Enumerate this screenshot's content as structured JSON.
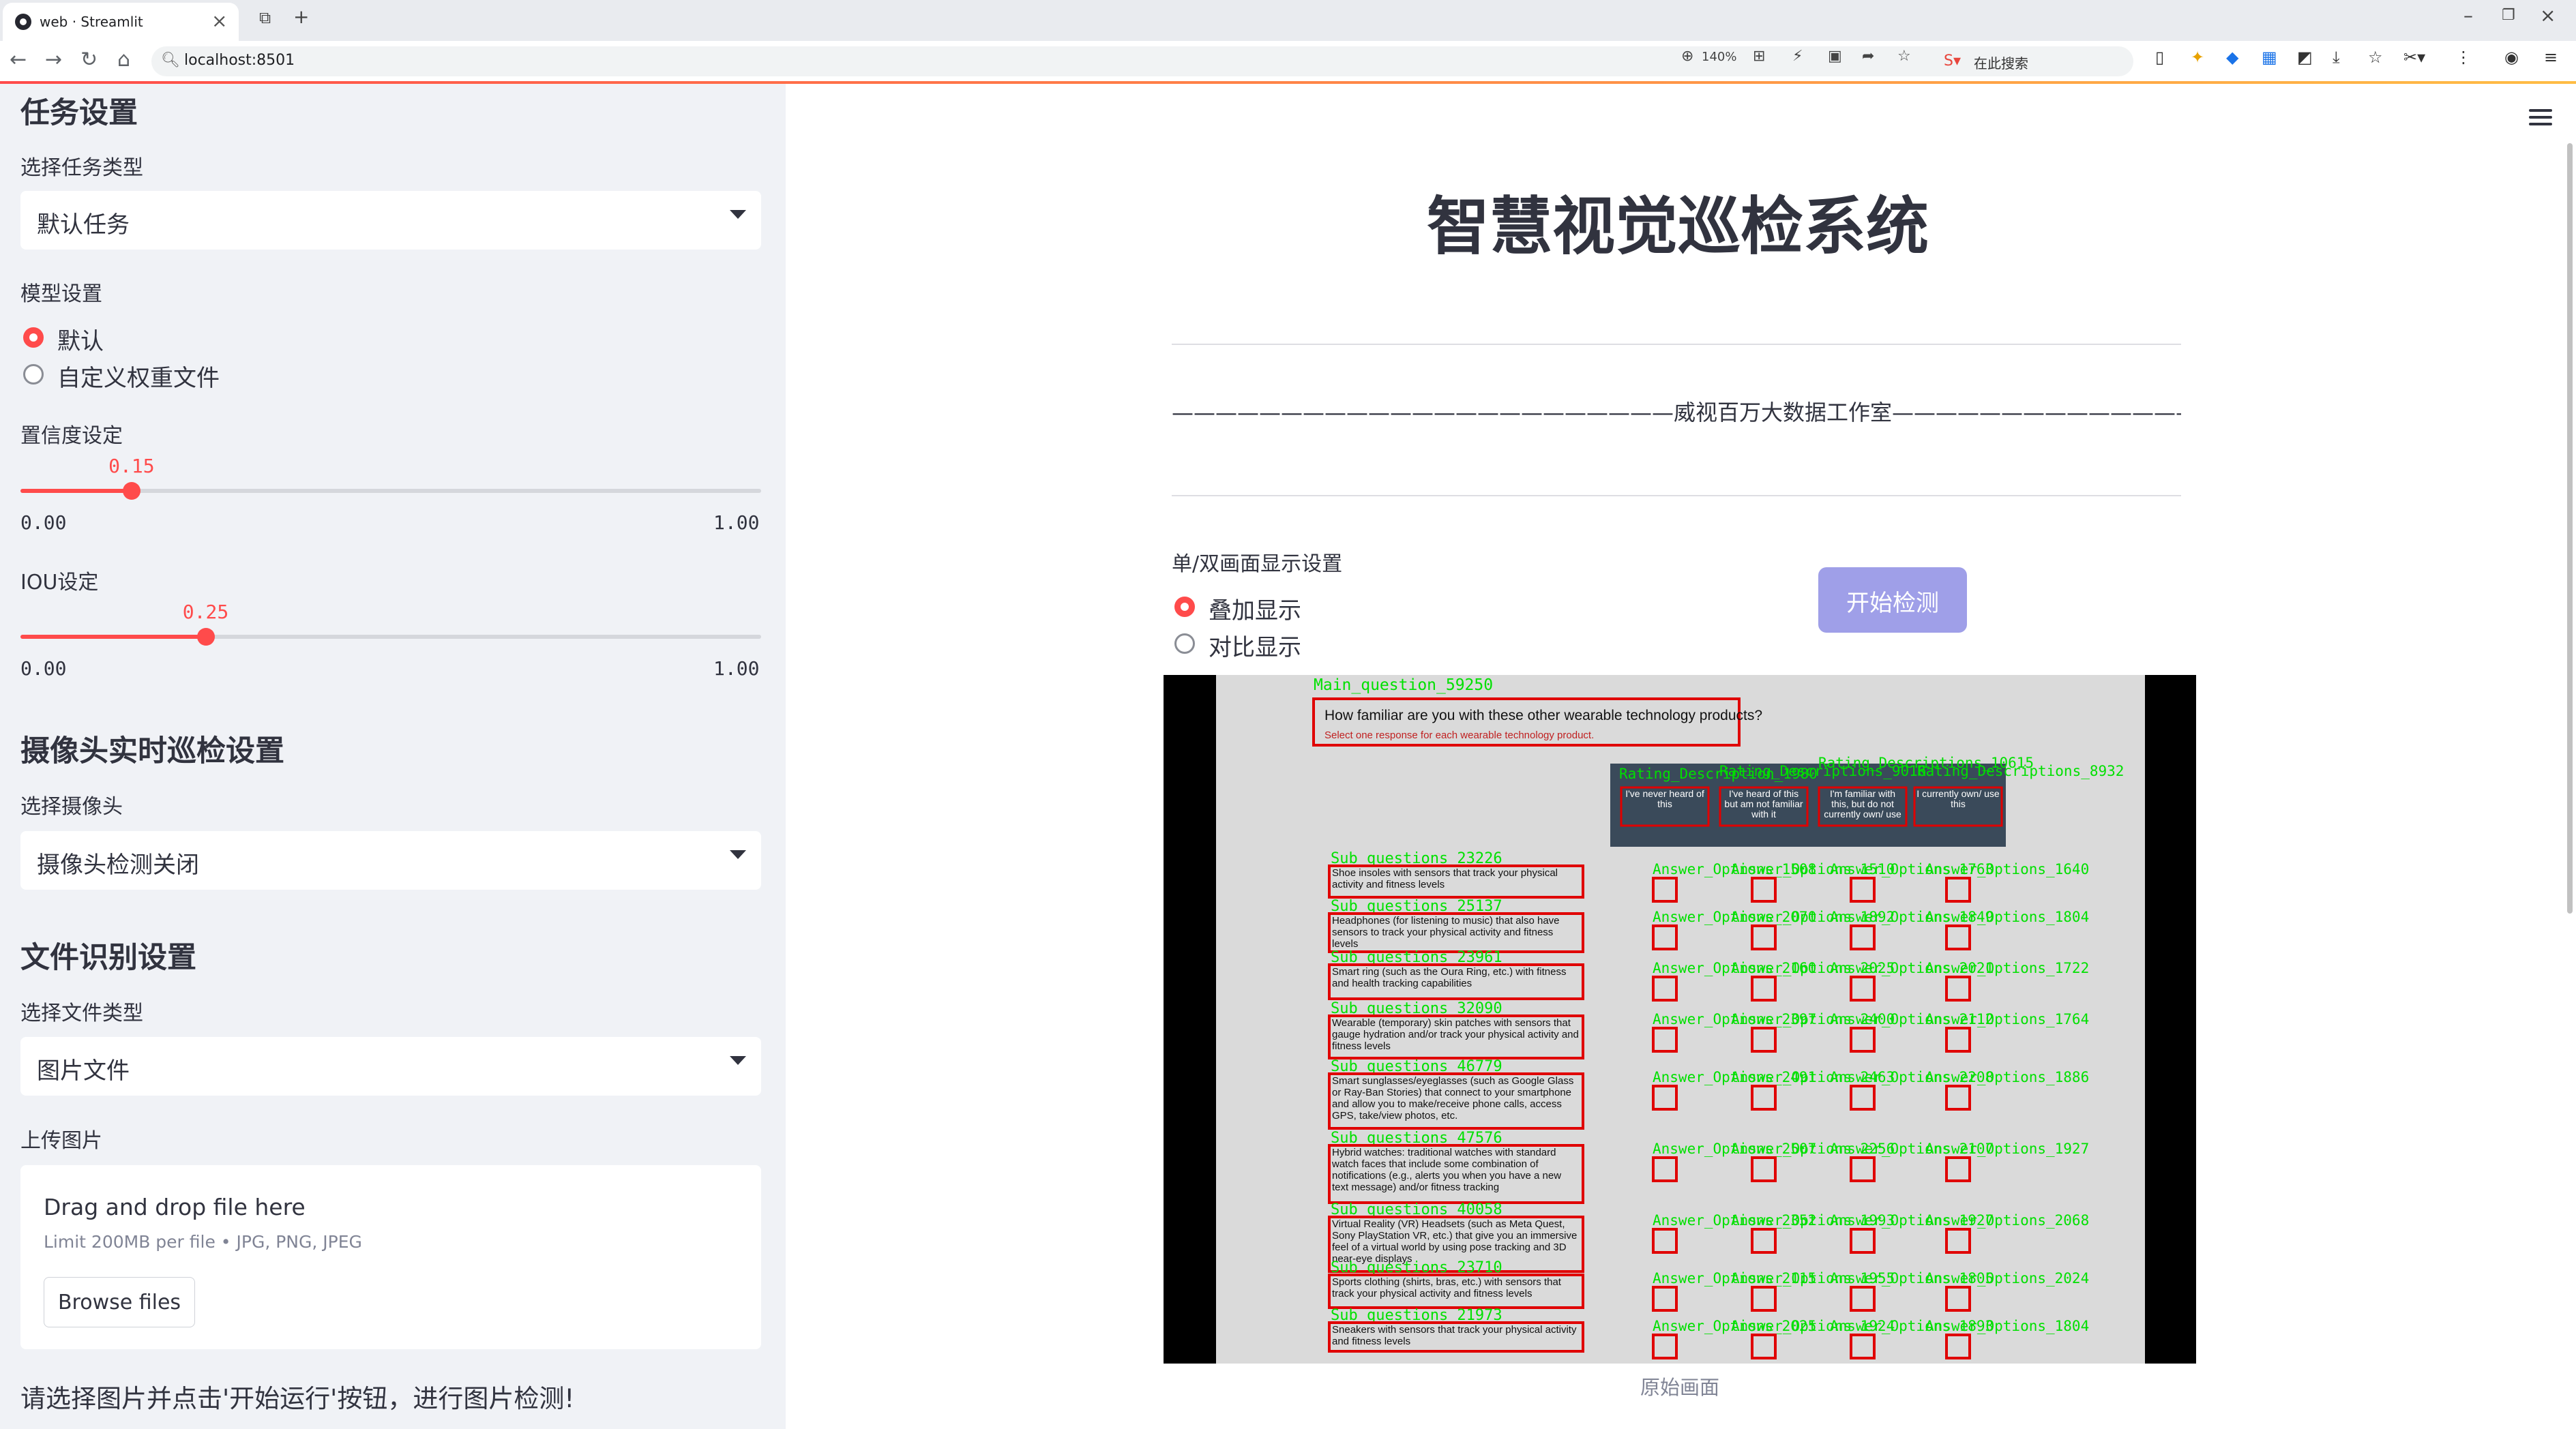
{
  "browser": {
    "tab_title": "web · Streamlit",
    "url": "localhost:8501",
    "zoom": "140%",
    "search_placeholder": "在此搜索"
  },
  "sidebar": {
    "task_heading": "任务设置",
    "task_type_label": "选择任务类型",
    "task_type_value": "默认任务",
    "model_label": "模型设置",
    "model_options": [
      "默认",
      "自定义权重文件"
    ],
    "model_selected": 0,
    "confidence": {
      "label": "置信度设定",
      "value": 0.15,
      "value_text": "0.15",
      "min": "0.00",
      "max": "1.00"
    },
    "iou": {
      "label": "IOU设定",
      "value": 0.25,
      "value_text": "0.25",
      "min": "0.00",
      "max": "1.00"
    },
    "camera_heading": "摄像头实时巡检设置",
    "camera_label": "选择摄像头",
    "camera_value": "摄像头检测关闭",
    "file_heading": "文件识别设置",
    "file_type_label": "选择文件类型",
    "file_type_value": "图片文件",
    "upload_label": "上传图片",
    "upload": {
      "drag_text": "Drag and drop file here",
      "limit_text": "Limit 200MB per file • JPG, PNG, JPEG",
      "browse_label": "Browse files"
    },
    "hint": "请选择图片并点击'开始运行'按钮，进行图片检测!"
  },
  "main": {
    "title": "智慧视觉巡检系统",
    "studio_line": "———————————————————————威视百万大数据工作室————————————————————————",
    "display_label": "单/双画面显示设置",
    "display_options": [
      "叠加显示",
      "对比显示"
    ],
    "display_selected": 0,
    "start_button": "开始检测",
    "image_caption": "原始画面"
  },
  "survey_image": {
    "main_question_tag": "Main_question_59250",
    "question": "How familiar are you with these other wearable technology products?",
    "question_note": "Select one response for each wearable technology product.",
    "rating_tags": [
      "Rating_Description_1980",
      "Rating_Descriptions_9016",
      "Rating_Descriptions_10615",
      "Rating_Descriptions_8932"
    ],
    "rating_headers": [
      "I've never heard of this",
      "I've heard of this but am not familiar with it",
      "I'm familiar with this, but do not currently own/ use",
      "I currently own/ use this"
    ],
    "rows": [
      {
        "tag": "Sub_questions_23226",
        "text": "Shoe insoles with sensors that track your physical activity and fitness levels",
        "answers": [
          "Answer_Options_1508",
          "Answer_Options_1510",
          "Answer_Options_1763",
          "Answer_Options_1640"
        ]
      },
      {
        "tag": "Sub_questions_25137",
        "text": "Headphones (for listening to music) that also have sensors to track your physical activity and fitness levels",
        "answers": [
          "Answer_Options_2070",
          "Answer_Options_1892",
          "Answer_Options_1849",
          "Answer_Options_1804"
        ]
      },
      {
        "tag": "Sub_questions_23961",
        "text": "Smart ring (such as the Oura Ring, etc.) with fitness and health tracking capabilities",
        "answers": [
          "Answer_Options_2160",
          "Answer_Options_2025",
          "Answer_Options_2021",
          "Answer_Options_1722"
        ]
      },
      {
        "tag": "Sub_questions_32090",
        "text": "Wearable (temporary) skin patches with sensors that gauge hydration and/or track your physical activity and fitness levels",
        "answers": [
          "Answer_Options_2397",
          "Answer_Options_2400",
          "Answer_Options_2112",
          "Answer_Options_1764"
        ]
      },
      {
        "tag": "Sub_questions_46779",
        "text": "Smart sunglasses/eyeglasses (such as Google Glass or Ray-Ban Stories) that connect to your smartphone and allow you to make/receive phone calls, access GPS, take/view photos, etc.",
        "answers": [
          "Answer_Options_2491",
          "Answer_Options_2463",
          "Answer_Options_2208",
          "Answer_Options_1886"
        ]
      },
      {
        "tag": "Sub_questions_47576",
        "text": "Hybrid watches: traditional watches with standard watch faces that include some combination of notifications (e.g., alerts you when you have a new text message) and/or fitness tracking",
        "answers": [
          "Answer_Options_2507",
          "Answer_Options_2256",
          "Answer_Options_2107",
          "Answer_Options_1927"
        ]
      },
      {
        "tag": "Sub_questions_40058",
        "text": "Virtual Reality (VR) Headsets (such as Meta Quest, Sony PlayStation VR, etc.) that give you an immersive feel of a virtual world by using pose tracking and 3D near-eye displays",
        "answers": [
          "Answer_Options_2352",
          "Answer_Options_1993",
          "Answer_Options_1927",
          "Answer_Options_2068"
        ]
      },
      {
        "tag": "Sub_questions_23710",
        "text": "Sports clothing (shirts, bras, etc.) with sensors that track your physical activity and fitness levels",
        "answers": [
          "Answer_Options_2115",
          "Answer_Options_1955",
          "Answer_Options_1805",
          "Answer_Options_2024"
        ]
      },
      {
        "tag": "Sub_questions_21973",
        "text": "Sneakers with sensors that track your physical activity and fitness levels",
        "answers": [
          "Answer_Options_2025",
          "Answer_Options_1924",
          "Answer_Options_1893",
          "Answer_Options_1804"
        ]
      }
    ]
  },
  "colors": {
    "accent": "#ff4b4b",
    "sidebar_bg": "#f0f2f6",
    "button": "#9f9fe8",
    "detect_box": "#e00000",
    "detect_label": "#00e000"
  }
}
